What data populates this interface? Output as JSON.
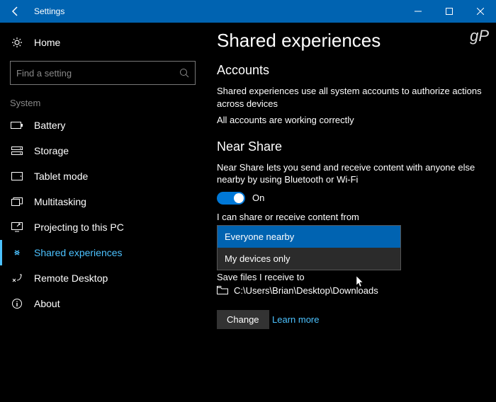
{
  "titlebar": {
    "title": "Settings"
  },
  "sidebar": {
    "home": "Home",
    "search_placeholder": "Find a setting",
    "group": "System",
    "items": [
      {
        "label": "Battery"
      },
      {
        "label": "Storage"
      },
      {
        "label": "Tablet mode"
      },
      {
        "label": "Multitasking"
      },
      {
        "label": "Projecting to this PC"
      },
      {
        "label": "Shared experiences"
      },
      {
        "label": "Remote Desktop"
      },
      {
        "label": "About"
      }
    ]
  },
  "main": {
    "heading": "Shared experiences",
    "accounts": {
      "title": "Accounts",
      "desc": "Shared experiences use all system accounts to authorize actions across devices",
      "status": "All accounts are working correctly"
    },
    "nearshare": {
      "title": "Near Share",
      "desc": "Near Share lets you send and receive content with anyone else nearby by using Bluetooth or Wi-Fi",
      "toggle_state": "On",
      "share_label": "I can share or receive content from",
      "options": [
        "Everyone nearby",
        "My devices only"
      ],
      "save_label": "Save files I receive to",
      "path": "C:\\Users\\Brian\\Desktop\\Downloads",
      "change": "Change"
    },
    "learn": "Learn more",
    "watermark": "gP"
  }
}
